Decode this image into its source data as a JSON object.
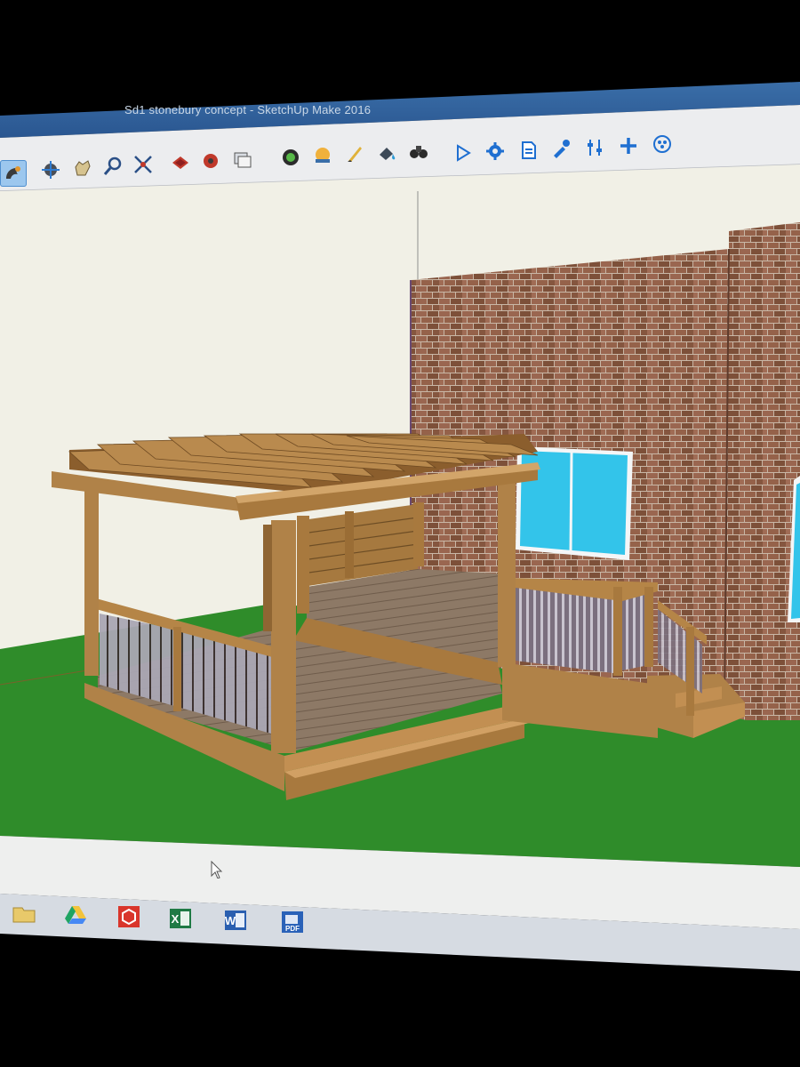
{
  "window": {
    "title": "Sd1 stonebury concept - SketchUp Make 2016"
  },
  "toolbar": {
    "tools": [
      {
        "name": "orbit-tool-icon",
        "active": true
      },
      {
        "name": "pan-tool-icon"
      },
      {
        "name": "hand-tool-icon"
      },
      {
        "name": "zoom-tool-icon"
      },
      {
        "name": "zoom-extents-icon"
      },
      {
        "name": "3d-warehouse-icon"
      },
      {
        "name": "extension-warehouse-icon"
      },
      {
        "name": "layout-icon"
      },
      {
        "name": "position-camera-icon"
      },
      {
        "name": "look-around-icon"
      },
      {
        "name": "walk-icon"
      },
      {
        "name": "paint-bucket-icon"
      },
      {
        "name": "binoculars-icon"
      },
      {
        "name": "play-icon"
      },
      {
        "name": "settings-gear-icon"
      },
      {
        "name": "document-icon"
      },
      {
        "name": "eyedropper-icon"
      },
      {
        "name": "sliders-icon"
      },
      {
        "name": "plus-icon"
      },
      {
        "name": "circle-pattern-icon"
      }
    ]
  },
  "taskbar": {
    "apps": [
      {
        "name": "file-explorer-icon"
      },
      {
        "name": "google-drive-icon"
      },
      {
        "name": "sketchup-icon"
      },
      {
        "name": "excel-icon",
        "letter": "X"
      },
      {
        "name": "word-icon",
        "letter": "W"
      },
      {
        "name": "pdf-app-icon",
        "label": "PDF"
      }
    ]
  },
  "colors": {
    "sky": "#f1f0e6",
    "grass": "#2f8c2a",
    "brick": "#8b5a42",
    "wood": "#a8793e",
    "glass": "#33c4ea"
  }
}
